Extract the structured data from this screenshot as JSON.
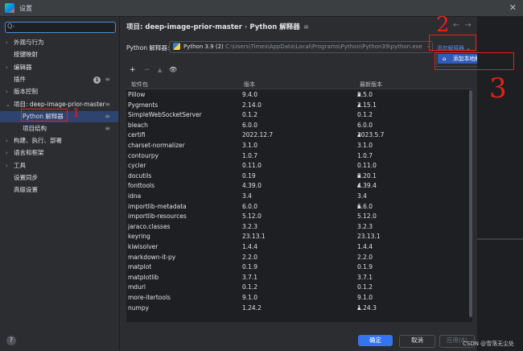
{
  "window": {
    "title": "设置"
  },
  "sidebar": {
    "search_placeholder": "Q-",
    "items": [
      {
        "label": "外观与行为",
        "chevron": "›"
      },
      {
        "label": "按键映射",
        "chevron": ""
      },
      {
        "label": "编辑器",
        "chevron": "›"
      },
      {
        "label": "插件",
        "chevron": "",
        "badge": "1"
      },
      {
        "label": "版本控制",
        "chevron": "›"
      },
      {
        "label": "项目: deep-image-prior-master",
        "chevron": "⌄"
      },
      {
        "label": "Python 解释器",
        "chevron": ""
      },
      {
        "label": "项目结构",
        "chevron": ""
      },
      {
        "label": "构建、执行、部署",
        "chevron": "›"
      },
      {
        "label": "语言和框架",
        "chevron": "›"
      },
      {
        "label": "工具",
        "chevron": "›"
      },
      {
        "label": "设置同步",
        "chevron": ""
      },
      {
        "label": "高级设置",
        "chevron": ""
      }
    ]
  },
  "breadcrumb": {
    "project": "项目: deep-image-prior-master",
    "sep": "›",
    "page": "Python 解释器"
  },
  "interpreter": {
    "label": "Python 解释器:",
    "name": "Python 3.9 (2)",
    "path": "C:\\Users\\Times\\AppData\\Local\\Programs\\Python\\Python39\\python.exe",
    "add_link": "添加解释器",
    "dropdown_item": "添加本地解释器..."
  },
  "toolbar": {
    "add": "+",
    "remove": "−",
    "up": "▲",
    "eye": "👁"
  },
  "table": {
    "headers": [
      "软件包",
      "版本",
      "最新版本"
    ],
    "rows": [
      [
        "Pillow",
        "9.4.0",
        "9.5.0",
        true
      ],
      [
        "Pygments",
        "2.14.0",
        "2.15.1",
        true
      ],
      [
        "SimpleWebSocketServer",
        "0.1.2",
        "0.1.2",
        false
      ],
      [
        "bleach",
        "6.0.0",
        "6.0.0",
        false
      ],
      [
        "certifi",
        "2022.12.7",
        "2023.5.7",
        true
      ],
      [
        "charset-normalizer",
        "3.1.0",
        "3.1.0",
        false
      ],
      [
        "contourpy",
        "1.0.7",
        "1.0.7",
        false
      ],
      [
        "cycler",
        "0.11.0",
        "0.11.0",
        false
      ],
      [
        "docutils",
        "0.19",
        "0.20.1",
        true
      ],
      [
        "fonttools",
        "4.39.0",
        "4.39.4",
        true
      ],
      [
        "idna",
        "3.4",
        "3.4",
        false
      ],
      [
        "importlib-metadata",
        "6.0.0",
        "6.6.0",
        true
      ],
      [
        "importlib-resources",
        "5.12.0",
        "5.12.0",
        false
      ],
      [
        "jaraco.classes",
        "3.2.3",
        "3.2.3",
        false
      ],
      [
        "keyring",
        "23.13.1",
        "23.13.1",
        false
      ],
      [
        "kiwisolver",
        "1.4.4",
        "1.4.4",
        false
      ],
      [
        "markdown-it-py",
        "2.2.0",
        "2.2.0",
        false
      ],
      [
        "matplot",
        "0.1.9",
        "0.1.9",
        false
      ],
      [
        "matplotlib",
        "3.7.1",
        "3.7.1",
        false
      ],
      [
        "mdurl",
        "0.1.2",
        "0.1.2",
        false
      ],
      [
        "more-itertools",
        "9.1.0",
        "9.1.0",
        false
      ],
      [
        "numpy",
        "1.24.2",
        "1.24.3",
        true
      ]
    ]
  },
  "buttons": {
    "ok": "确定",
    "cancel": "取消",
    "apply": "应用(A)"
  },
  "annotations": {
    "n1": "1",
    "n2": "2",
    "n3": "3"
  },
  "watermark": "CSDN @雪落无尘处"
}
